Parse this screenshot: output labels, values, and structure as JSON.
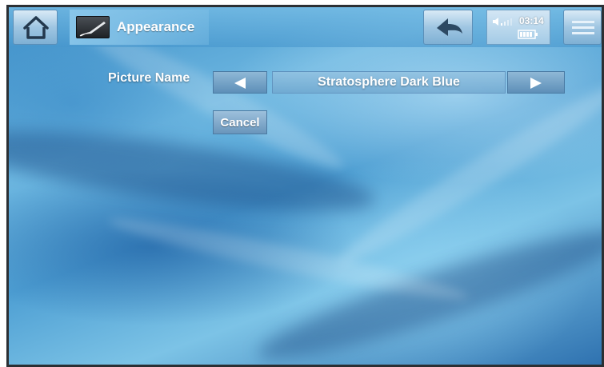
{
  "header": {
    "title": "Appearance",
    "title_icon": "paintbrush-icon",
    "home_icon": "home-icon",
    "back_icon": "back-arrow-icon",
    "menu_icon": "menu-icon"
  },
  "status": {
    "time": "03:14",
    "volume_icon": "volume-icon",
    "battery_icon": "battery-icon"
  },
  "setting": {
    "label": "Picture Name",
    "value": "Stratosphere Dark Blue",
    "prev_icon": "triangle-left-icon",
    "next_icon": "triangle-right-icon"
  },
  "actions": {
    "cancel_label": "Cancel"
  },
  "colors": {
    "background_primary": "#4e9fd3",
    "text": "#ffffff",
    "dark_button": "#2b2f33"
  }
}
